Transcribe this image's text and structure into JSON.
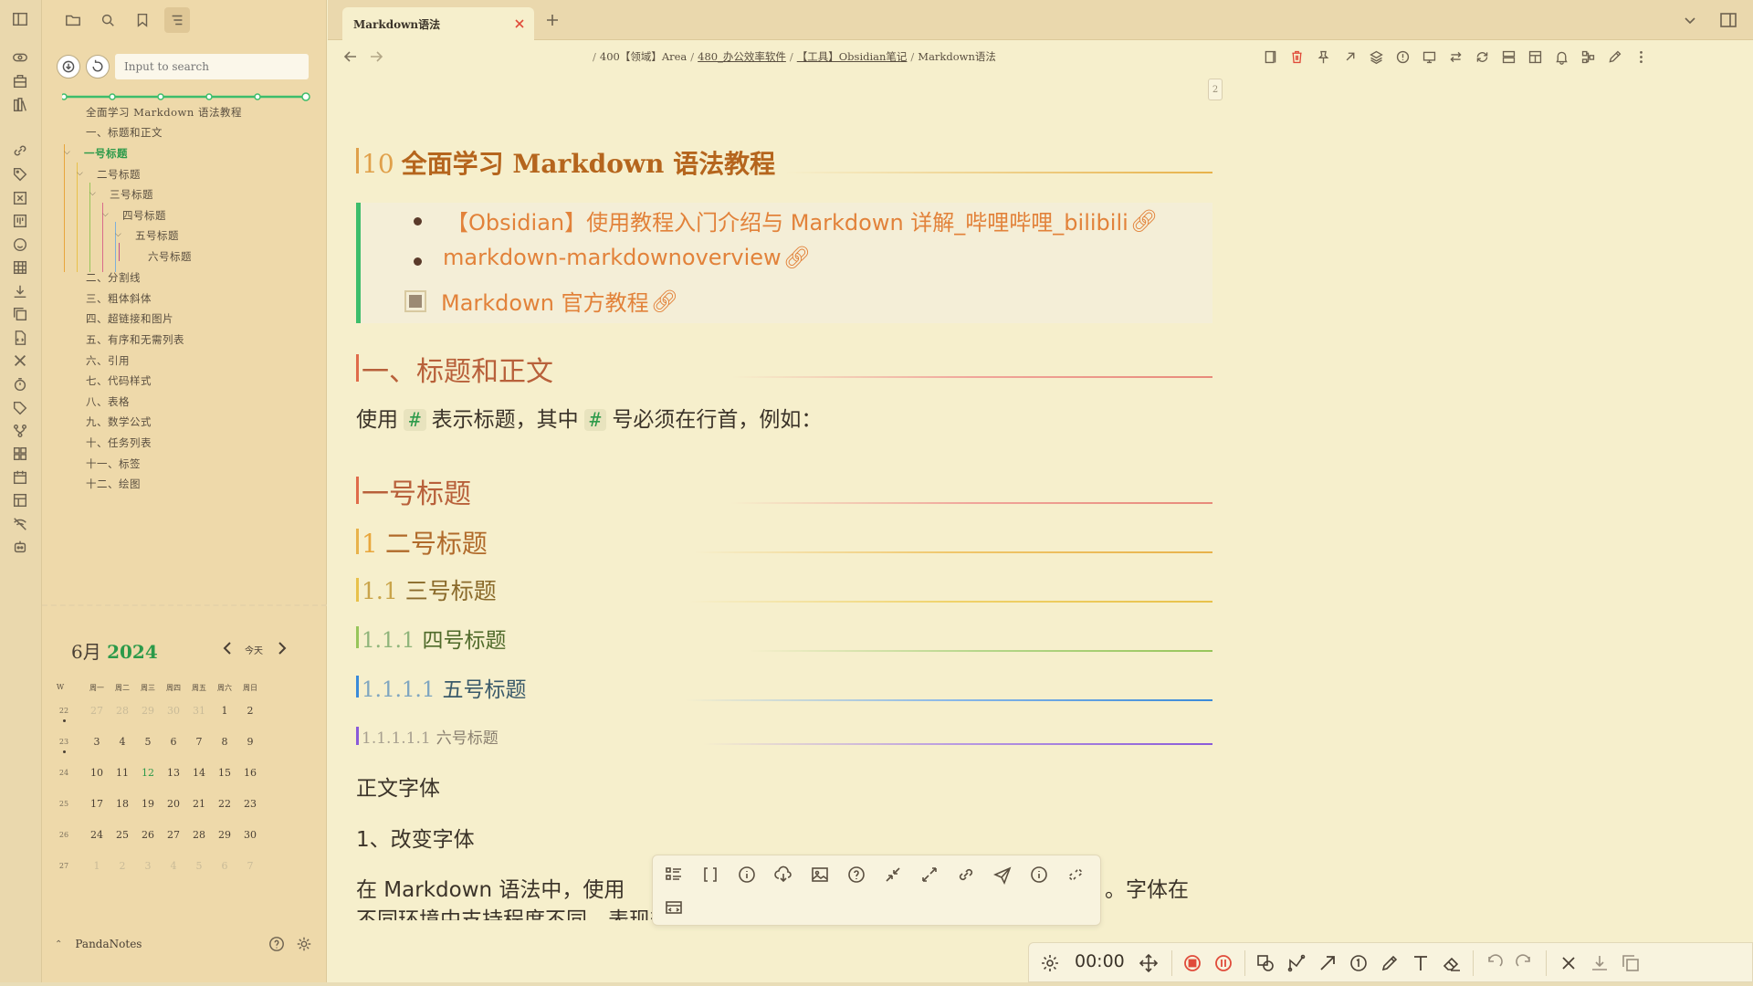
{
  "tab": {
    "title": "Markdown语法"
  },
  "breadcrumb": [
    "400【领域】Area",
    "480_办公效率软件",
    "【工具】Obsidian笔记",
    "Markdown语法"
  ],
  "outline": {
    "search_placeholder": "Input to search",
    "items": [
      {
        "label": "全面学习 Markdown 语法教程",
        "level": 0
      },
      {
        "label": "一、标题和正文",
        "level": 0
      },
      {
        "label": "一号标题",
        "level": 0,
        "active": true,
        "expanded": true
      },
      {
        "label": "二号标题",
        "level": 1,
        "expanded": true
      },
      {
        "label": "三号标题",
        "level": 2,
        "expanded": true
      },
      {
        "label": "四号标题",
        "level": 3,
        "expanded": true
      },
      {
        "label": "五号标题",
        "level": 4,
        "expanded": true
      },
      {
        "label": "六号标题",
        "level": 5
      },
      {
        "label": "二、分割线",
        "level": 0
      },
      {
        "label": "三、粗体斜体",
        "level": 0
      },
      {
        "label": "四、超链接和图片",
        "level": 0
      },
      {
        "label": "五、有序和无需列表",
        "level": 0
      },
      {
        "label": "六、引用",
        "level": 0
      },
      {
        "label": "七、代码样式",
        "level": 0
      },
      {
        "label": "八、表格",
        "level": 0
      },
      {
        "label": "九、数学公式",
        "level": 0
      },
      {
        "label": "十、任务列表",
        "level": 0
      },
      {
        "label": "十一、标签",
        "level": 0
      },
      {
        "label": "十二、绘图",
        "level": 0
      }
    ]
  },
  "calendar": {
    "month": "6月",
    "year": "2024",
    "today_label": "今天",
    "headers": [
      "W",
      "周一",
      "周二",
      "周三",
      "周四",
      "周五",
      "周六",
      "周日"
    ],
    "weeks": [
      {
        "wk": "22",
        "days": [
          "27",
          "28",
          "29",
          "30",
          "31",
          "1",
          "2"
        ],
        "muted": [
          0,
          1,
          2,
          3,
          4
        ],
        "dot": true
      },
      {
        "wk": "23",
        "days": [
          "3",
          "4",
          "5",
          "6",
          "7",
          "8",
          "9"
        ],
        "muted": [],
        "dot": true
      },
      {
        "wk": "24",
        "days": [
          "10",
          "11",
          "12",
          "13",
          "14",
          "15",
          "16"
        ],
        "muted": [],
        "today": 2
      },
      {
        "wk": "25",
        "days": [
          "17",
          "18",
          "19",
          "20",
          "21",
          "22",
          "23"
        ],
        "muted": []
      },
      {
        "wk": "26",
        "days": [
          "24",
          "25",
          "26",
          "27",
          "28",
          "29",
          "30"
        ],
        "muted": []
      },
      {
        "wk": "27",
        "days": [
          "1",
          "2",
          "3",
          "4",
          "5",
          "6",
          "7"
        ],
        "muted": [
          0,
          1,
          2,
          3,
          4,
          5,
          6
        ]
      }
    ]
  },
  "vault": {
    "name": "PandaNotes"
  },
  "page_counter": "2",
  "doc": {
    "h1_num": "10",
    "h1_text": "全面学习 Markdown 语法教程",
    "callout_items": [
      {
        "type": "bullet",
        "text": "【Obsidian】使用教程入门介绍与 Markdown 详解_哔哩哔哩_bilibili"
      },
      {
        "type": "bullet",
        "text": "markdown-markdownoverview"
      },
      {
        "type": "checkbox",
        "text": "Markdown 官方教程"
      }
    ],
    "section1": "一、标题和正文",
    "intro_before": "使用",
    "intro_code1": "#",
    "intro_mid": "表示标题，其中",
    "intro_code2": "#",
    "intro_after": "号必须在行首，例如：",
    "h_level1": "一号标题",
    "h_level2_num": "1",
    "h_level2": "二号标题",
    "h_level3_num": "1.1",
    "h_level3": "三号标题",
    "h_level4_num": "1.1.1",
    "h_level4": "四号标题",
    "h_level5_num": "1.1.1.1",
    "h_level5": "五号标题",
    "h_level6_num": "1.1.1.1.1",
    "h_level6": "六号标题",
    "p_font": "正文字体",
    "p_change_font": "1、改变字体",
    "p_line1_left": "在 Markdown 语法中，使用",
    "p_line1_right": "。字体在",
    "p_line2": "不同环境中支持程度不同，表现效果可能也不同。"
  },
  "drawing": {
    "timer": "00:00"
  },
  "colors": {
    "accent_green": "#2c9a4a",
    "h1": "#b5651d",
    "h2": "#b8603a",
    "link": "#e2823a",
    "danger": "#e04b3a"
  }
}
